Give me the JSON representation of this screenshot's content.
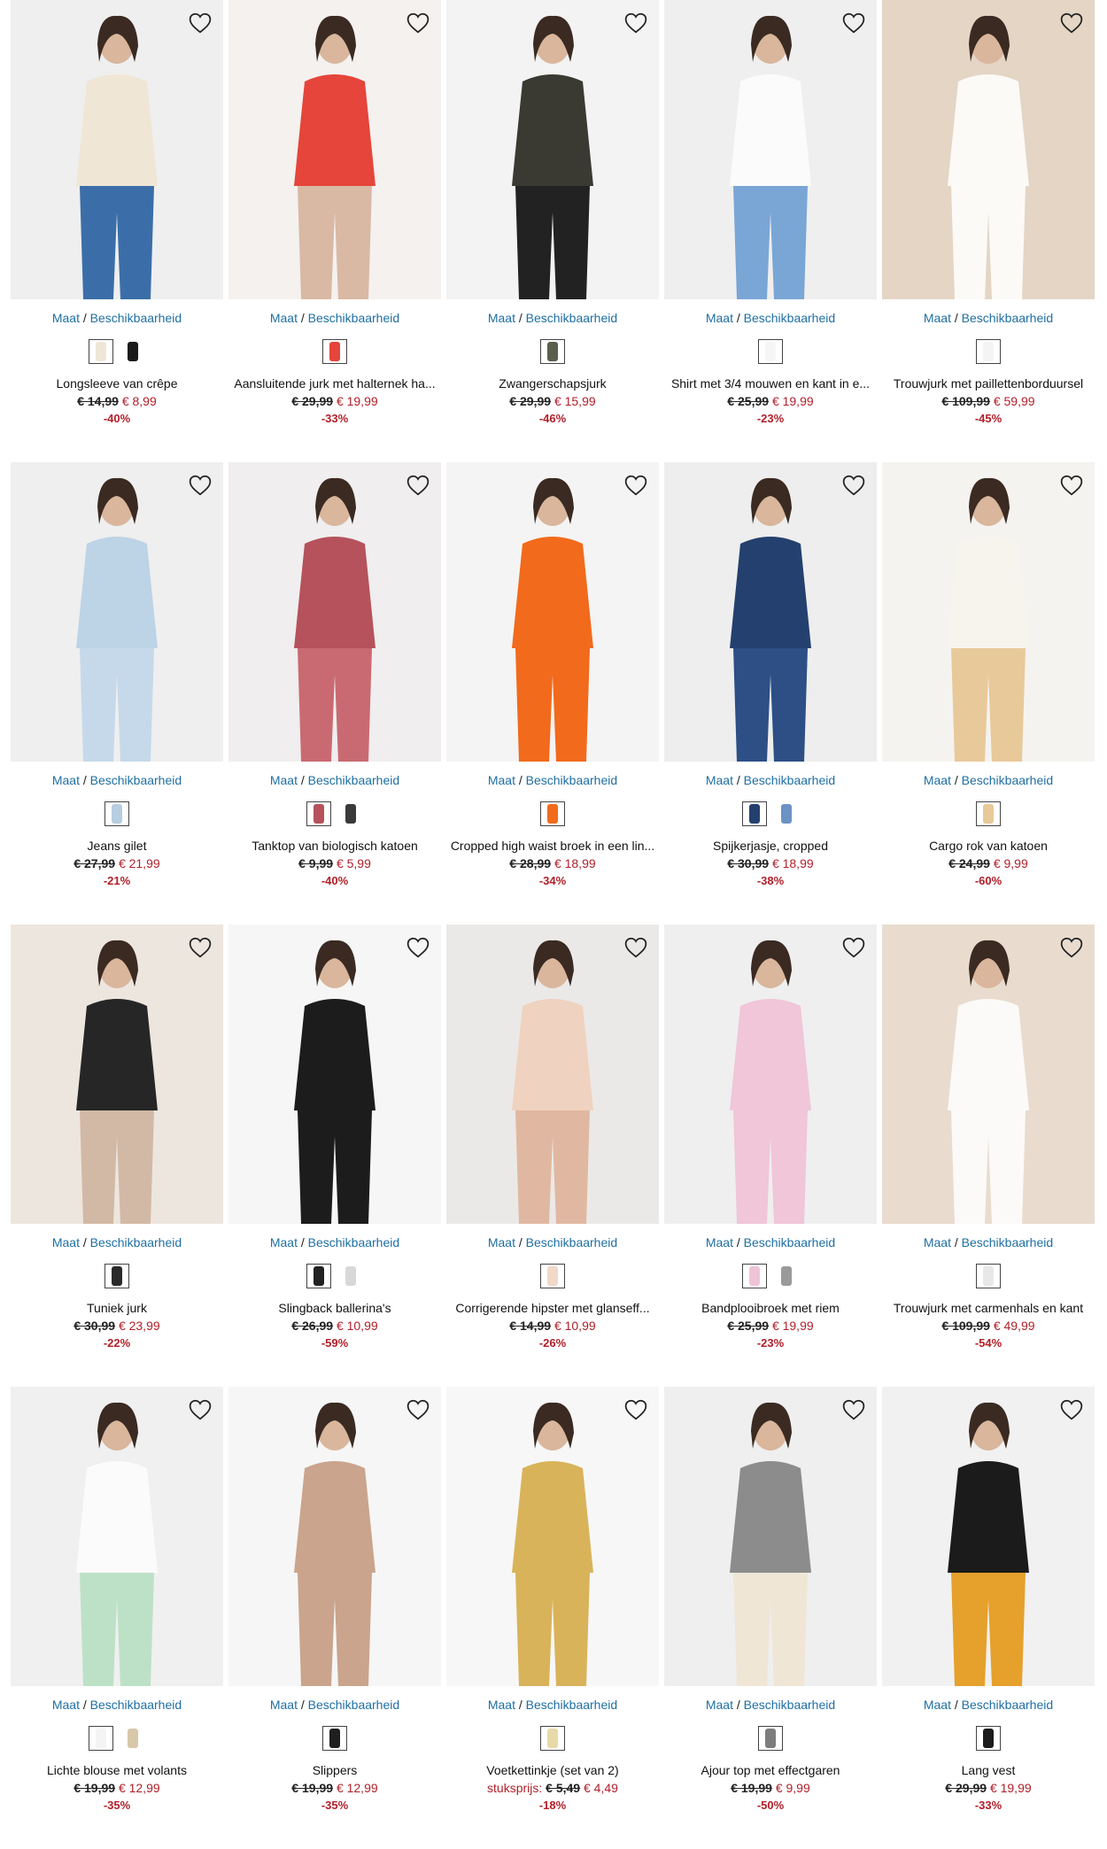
{
  "labels": {
    "size_link": "Maat",
    "size_sep": " / ",
    "availability_link": "Beschikbaarheid"
  },
  "icons": {
    "favorite": "heart-outline-icon"
  },
  "colors": {
    "link": "#1f6fa3",
    "sale": "#b0202a"
  },
  "products": [
    {
      "name": "Longsleeve van crêpe",
      "old_price": "€ 14,99",
      "new_price": "€ 8,99",
      "discount": "-40%",
      "swatches": [
        "#efe6d6",
        "#1b1b1b"
      ],
      "bg": "#efeff0",
      "fig": "#efe6d6",
      "legs": "#3b6ea8"
    },
    {
      "name": "Aansluitende jurk met halternek ha...",
      "old_price": "€ 29,99",
      "new_price": "€ 19,99",
      "discount": "-33%",
      "swatches": [
        "#e5453a"
      ],
      "bg": "#f4f1ef",
      "fig": "#e5453a",
      "legs": "#d9b9a4"
    },
    {
      "name": "Zwangerschapsjurk",
      "old_price": "€ 29,99",
      "new_price": "€ 15,99",
      "discount": "-46%",
      "swatches": [
        "#5a5f4e"
      ],
      "bg": "#f3f3f3",
      "fig": "#3a3a33",
      "legs": "#222222"
    },
    {
      "name": "Shirt met 3/4 mouwen en kant in e...",
      "old_price": "€ 25,99",
      "new_price": "€ 19,99",
      "discount": "-23%",
      "swatches": [
        "#f6f6f6"
      ],
      "bg": "#efefef",
      "fig": "#fbfbfb",
      "legs": "#7aa6d6"
    },
    {
      "name": "Trouwjurk met paillettenborduursel",
      "old_price": "€ 109,99",
      "new_price": "€ 59,99",
      "discount": "-45%",
      "swatches": [
        "#f4f4f4"
      ],
      "bg": "#e4d5c5",
      "fig": "#fbfaf7",
      "legs": "#fbfaf7"
    },
    {
      "name": "Jeans gilet",
      "old_price": "€ 27,99",
      "new_price": "€ 21,99",
      "discount": "-21%",
      "swatches": [
        "#b7cde0"
      ],
      "bg": "#efefef",
      "fig": "#bdd3e6",
      "legs": "#c6d9ea"
    },
    {
      "name": "Tanktop van biologisch katoen",
      "old_price": "€ 9,99",
      "new_price": "€ 5,99",
      "discount": "-40%",
      "swatches": [
        "#b5525c",
        "#3a3a3a"
      ],
      "bg": "#f0eeee",
      "fig": "#b5525c",
      "legs": "#c96a72"
    },
    {
      "name": "Cropped high waist broek in een lin...",
      "old_price": "€ 28,99",
      "new_price": "€ 18,99",
      "discount": "-34%",
      "swatches": [
        "#f26a1b"
      ],
      "bg": "#f4f4f4",
      "fig": "#f26a1b",
      "legs": "#f26a1b"
    },
    {
      "name": "Spijkerjasje, cropped",
      "old_price": "€ 30,99",
      "new_price": "€ 18,99",
      "discount": "-38%",
      "swatches": [
        "#24406e",
        "#6b93c4"
      ],
      "bg": "#eeeeee",
      "fig": "#24406e",
      "legs": "#2d4f86"
    },
    {
      "name": "Cargo rok van katoen",
      "old_price": "€ 24,99",
      "new_price": "€ 9,99",
      "discount": "-60%",
      "swatches": [
        "#e8c99a"
      ],
      "bg": "#f5f3f0",
      "fig": "#f7f4ee",
      "legs": "#e8c99a"
    },
    {
      "name": "Tuniek jurk",
      "old_price": "€ 30,99",
      "new_price": "€ 23,99",
      "discount": "-22%",
      "swatches": [
        "#2a2a2a"
      ],
      "bg": "#ede6df",
      "fig": "#262626",
      "legs": "#d2b9a5"
    },
    {
      "name": "Slingback ballerina's",
      "old_price": "€ 26,99",
      "new_price": "€ 10,99",
      "discount": "-59%",
      "swatches": [
        "#222222",
        "#d8d8d8"
      ],
      "bg": "#f6f6f6",
      "fig": "#1c1c1c",
      "legs": "#1c1c1c"
    },
    {
      "name": "Corrigerende hipster met glanseff...",
      "old_price": "€ 14,99",
      "new_price": "€ 10,99",
      "discount": "-26%",
      "swatches": [
        "#f1d8c8"
      ],
      "bg": "#ebe9e7",
      "fig": "#efd2bf",
      "legs": "#e0b8a1"
    },
    {
      "name": "Bandplooibroek met riem",
      "old_price": "€ 25,99",
      "new_price": "€ 19,99",
      "discount": "-23%",
      "swatches": [
        "#efc4d7",
        "#9a9a9a"
      ],
      "bg": "#efefef",
      "fig": "#f0c6d8",
      "legs": "#f0c6d8"
    },
    {
      "name": "Trouwjurk met carmenhals en kant",
      "old_price": "€ 109,99",
      "new_price": "€ 49,99",
      "discount": "-54%",
      "swatches": [
        "#e8e8e8"
      ],
      "bg": "#e9dccf",
      "fig": "#fbfaf8",
      "legs": "#fbfaf8"
    },
    {
      "name": "Lichte blouse met volants",
      "old_price": "€ 19,99",
      "new_price": "€ 12,99",
      "discount": "-35%",
      "swatches": [
        "#f4f4f4",
        "#d6c8a8"
      ],
      "bg": "#f0f0f0",
      "fig": "#fbfbfb",
      "legs": "#bde1c7"
    },
    {
      "name": "Slippers",
      "old_price": "€ 19,99",
      "new_price": "€ 12,99",
      "discount": "-35%",
      "swatches": [
        "#1f1f1f"
      ],
      "bg": "#f6f6f6",
      "fig": "#caa48c",
      "legs": "#caa48c"
    },
    {
      "name": "Voetkettinkje (set van 2)",
      "prefix": "stuksprijs:",
      "old_price": "€ 5,49",
      "new_price": "€ 4,49",
      "discount": "-18%",
      "swatches": [
        "#e8d9a8"
      ],
      "bg": "#f7f7f7",
      "fig": "#d9b35a",
      "legs": "#d9b35a"
    },
    {
      "name": "Ajour top met effectgaren",
      "old_price": "€ 19,99",
      "new_price": "€ 9,99",
      "discount": "-50%",
      "swatches": [
        "#7d7d7d"
      ],
      "bg": "#efefef",
      "fig": "#8c8c8c",
      "legs": "#efe6d6"
    },
    {
      "name": "Lang vest",
      "old_price": "€ 29,99",
      "new_price": "€ 19,99",
      "discount": "-33%",
      "swatches": [
        "#1b1b1b"
      ],
      "bg": "#f1f1f1",
      "fig": "#1b1b1b",
      "legs": "#e6a02c"
    }
  ]
}
